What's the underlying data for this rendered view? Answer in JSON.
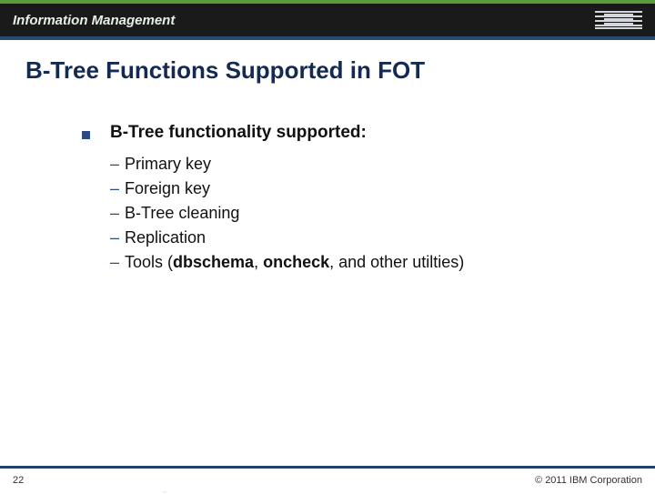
{
  "header": {
    "brand": "Information Management",
    "logo_name": "ibm-logo"
  },
  "slide": {
    "title": "B-Tree Functions Supported in FOT",
    "lead": "B-Tree functionality supported:",
    "items": [
      {
        "text": "Primary key"
      },
      {
        "text": "Foreign key"
      },
      {
        "text": "B-Tree cleaning"
      },
      {
        "text": "Replication"
      },
      {
        "prefix": "Tools (",
        "bold1": "dbschema",
        "mid": ", ",
        "bold2": "oncheck",
        "suffix": ", and other utilties)"
      }
    ]
  },
  "footer": {
    "page": "22",
    "copyright": "© 2011 IBM Corporation"
  }
}
